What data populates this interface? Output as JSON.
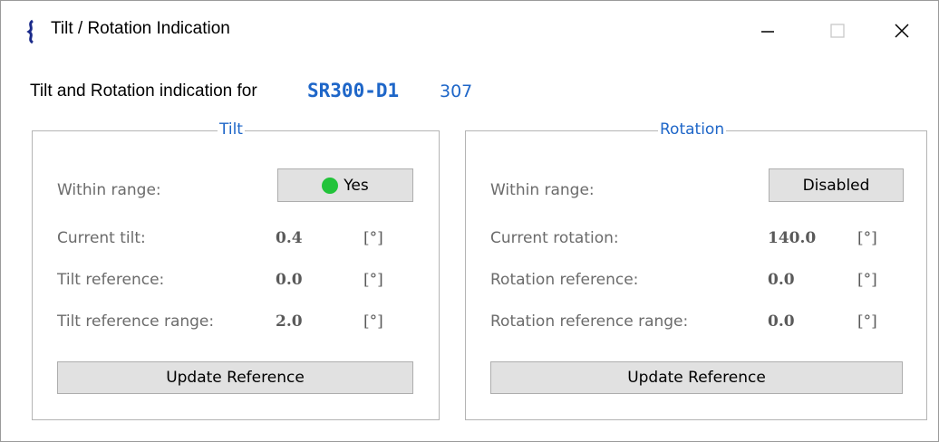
{
  "window": {
    "title": "Tilt / Rotation Indication",
    "minimize_symbol": "minimize-icon",
    "maximize_symbol": "maximize-icon",
    "close_symbol": "close-icon"
  },
  "header": {
    "prefix": "Tilt and Rotation indication for",
    "device_model": "SR300-D1",
    "device_serial": "307",
    "accent_color": "#1e66c8"
  },
  "tilt": {
    "caption": "Tilt",
    "within_range_label": "Within range:",
    "within_range_value": "Yes",
    "status_color": "#22c33a",
    "rows": [
      {
        "label": "Current tilt:",
        "value": "0.4",
        "unit": "[°]"
      },
      {
        "label": "Tilt reference:",
        "value": "0.0",
        "unit": "[°]"
      },
      {
        "label": "Tilt reference range:",
        "value": "2.0",
        "unit": "[°]"
      }
    ],
    "update_button": "Update Reference"
  },
  "rotation": {
    "caption": "Rotation",
    "within_range_label": "Within range:",
    "within_range_value": "Disabled",
    "rows": [
      {
        "label": "Current rotation:",
        "value": "140.0",
        "unit": "[°]"
      },
      {
        "label": "Rotation reference:",
        "value": "0.0",
        "unit": "[°]"
      },
      {
        "label": "Rotation reference range:",
        "value": "0.0",
        "unit": "[°]"
      }
    ],
    "update_button": "Update Reference"
  }
}
